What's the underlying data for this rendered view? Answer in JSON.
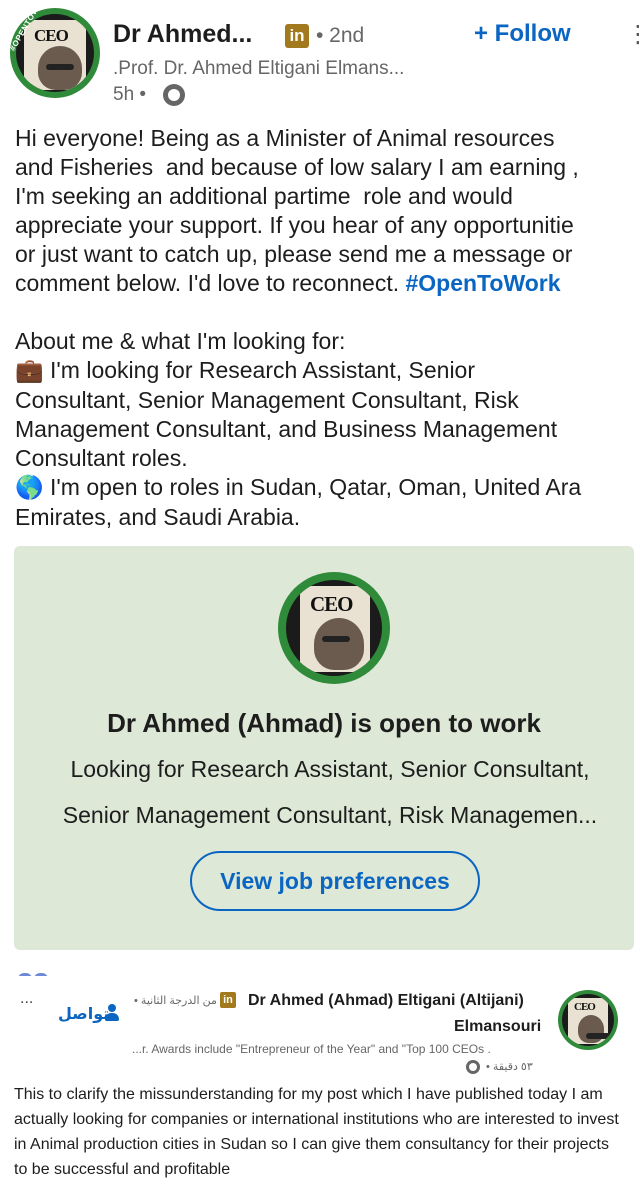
{
  "post": {
    "author_name": "Dr Ahmed...",
    "network_badge": "in",
    "connection_degree": "• 2nd",
    "follow_label": "+ Follow",
    "more_label": "⋮",
    "headline": ".Prof. Dr. Ahmed Eltigani Elmans...",
    "posted_ago": "5h •",
    "avatar_cover_text": "CEO",
    "avatar_frame_text": "#OPENTOWORK",
    "body_paragraph_1": "Hi everyone! Being as a Minister of Animal resources\nand Fisheries  and because of low salary I am earning ,\nI'm seeking an additional partime  role and would\nappreciate your support. If you hear of any opportunitie\nor just want to catch up, please send me a message or\ncomment below. I'd love to reconnect. ",
    "hashtag": "#OpenToWork",
    "body_heading": "About me & what I'm looking for:",
    "roles_emoji": "💼",
    "roles_text": " I'm looking for Research Assistant, Senior\nConsultant, Senior Management Consultant, Risk\nManagement Consultant, and Business Management\nConsultant roles.",
    "locations_emoji": "🌎",
    "locations_text": " I'm open to roles in Sudan, Qatar, Oman, United Ara\nEmirates, and Saudi Arabia."
  },
  "open_to_work_card": {
    "title": "Dr Ahmed (Ahmad) is open to work",
    "line_1": "Looking for Research Assistant, Senior Consultant,",
    "line_2": "Senior Management Consultant, Risk Managemen...",
    "button_label": "View job preferences"
  },
  "second_post": {
    "more_label": "...",
    "connect_label": "تواصل",
    "degree": "• من الدرجة الثانية",
    "network_badge": "in",
    "author_name_line_1": "Dr Ahmed (Ahmad) Eltigani (Altijani)",
    "author_name_line_2": "Elmansouri",
    "headline": "...r. Awards include \"Entrepreneur of the Year\" and \"Top 100 CEOs .",
    "posted_ago": "• ٥٣ دقيقة",
    "body": "This to clarify the missunderstanding for my post which I have published today I am actually looking for companies or international institutions who are interested to invest in Animal production cities in Sudan so I can give them consultancy for their projects to be successful and profitable"
  },
  "colors": {
    "link_blue": "#0a66c2",
    "card_green": "#dde8d7",
    "frame_green": "#2f8a3a",
    "badge_gold": "#a27a1d"
  }
}
